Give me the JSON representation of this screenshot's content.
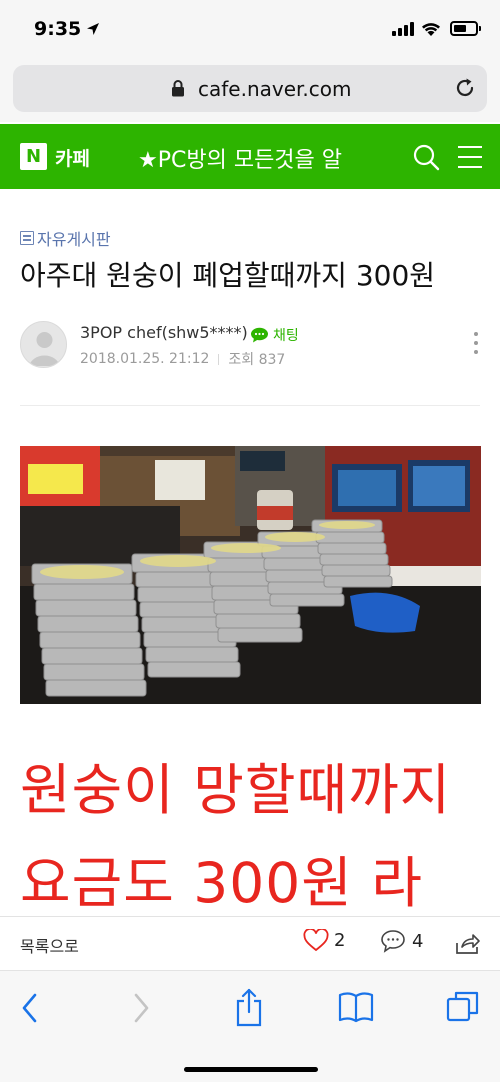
{
  "status_bar": {
    "time": "9:35"
  },
  "browser": {
    "url": "cafe.naver.com"
  },
  "cafe_header": {
    "logo": "N",
    "cafe_label": "카페",
    "title": "★PC방의 모든것을 알"
  },
  "article": {
    "board": "자유게시판",
    "title": "아주대 원숭이 폐업할때까지 300원",
    "author": "3POP chef(shw5****)",
    "chat_label": "채팅",
    "date": "2018.01.25. 21:12",
    "views": "조회 837",
    "body_lines": [
      "원숭이 망할때까지",
      "요금도 300원 라"
    ]
  },
  "article_bar": {
    "list_label": "목록으로",
    "likes": "2",
    "comments": "4"
  },
  "colors": {
    "naver_green": "#2db400",
    "body_red": "#e8261f",
    "safari_blue": "#1a73e8"
  },
  "icons": [
    "location-arrow-icon",
    "signal-icon",
    "wifi-icon",
    "battery-icon",
    "lock-icon",
    "reload-icon",
    "search-icon",
    "menu-icon",
    "board-icon",
    "chat-icon",
    "more-icon",
    "heart-icon",
    "comment-icon",
    "share-icon",
    "back-icon",
    "forward-icon",
    "safari-share-icon",
    "bookmarks-icon",
    "tabs-icon"
  ]
}
